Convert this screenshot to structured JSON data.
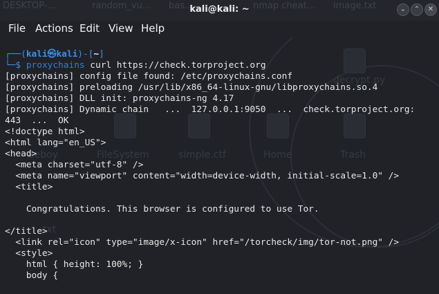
{
  "window": {
    "title": "kali@kali: ~",
    "minimize_glyph": "⌄",
    "maximize_glyph": "⌃",
    "close_glyph": "✕"
  },
  "background_tabs": [
    "DESKTOP-...",
    "random_vu...",
    "bas...",
    "nmap cheat...",
    "image.txt"
  ],
  "menu": [
    "File",
    "Actions",
    "Edit",
    "View",
    "Help"
  ],
  "desktop_labels": [
    "FileSystem",
    "simple.ctf",
    "Home",
    "Trash",
    "decrypt.py",
    "Beboy",
    "txt"
  ],
  "prompt": {
    "open": "┌──(",
    "user": "kali",
    "at": "㉿",
    "host": "kali",
    "mid": ")-[",
    "path": "~",
    "close": "]",
    "cmd_prefix": "└─$ ",
    "command_word": "proxychains",
    "command_rest": " curl https://check.torproject.org"
  },
  "terminal_lines": [
    "[proxychains] config file found: /etc/proxychains.conf",
    "[proxychains] preloading /usr/lib/x86_64-linux-gnu/libproxychains.so.4",
    "[proxychains] DLL init: proxychains-ng 4.17",
    "[proxychains] Dynamic chain   ...  127.0.0.1:9050  ...  check.torproject.org:",
    "443  ...  OK",
    "<!doctype html>",
    "<html lang=\"en_US\">",
    "<head>",
    "  <meta charset=\"utf-8\" />",
    "  <meta name=\"viewport\" content=\"width=device-width, initial-scale=1.0\" />",
    "  <title>",
    "",
    "    Congratulations. This browser is configured to use Tor.",
    "",
    "</title>",
    "  <link rel=\"icon\" type=\"image/x-icon\" href=\"/torcheck/img/tor-not.png\" />",
    "  <style>",
    "    html { height: 100%; }",
    "    body {"
  ]
}
